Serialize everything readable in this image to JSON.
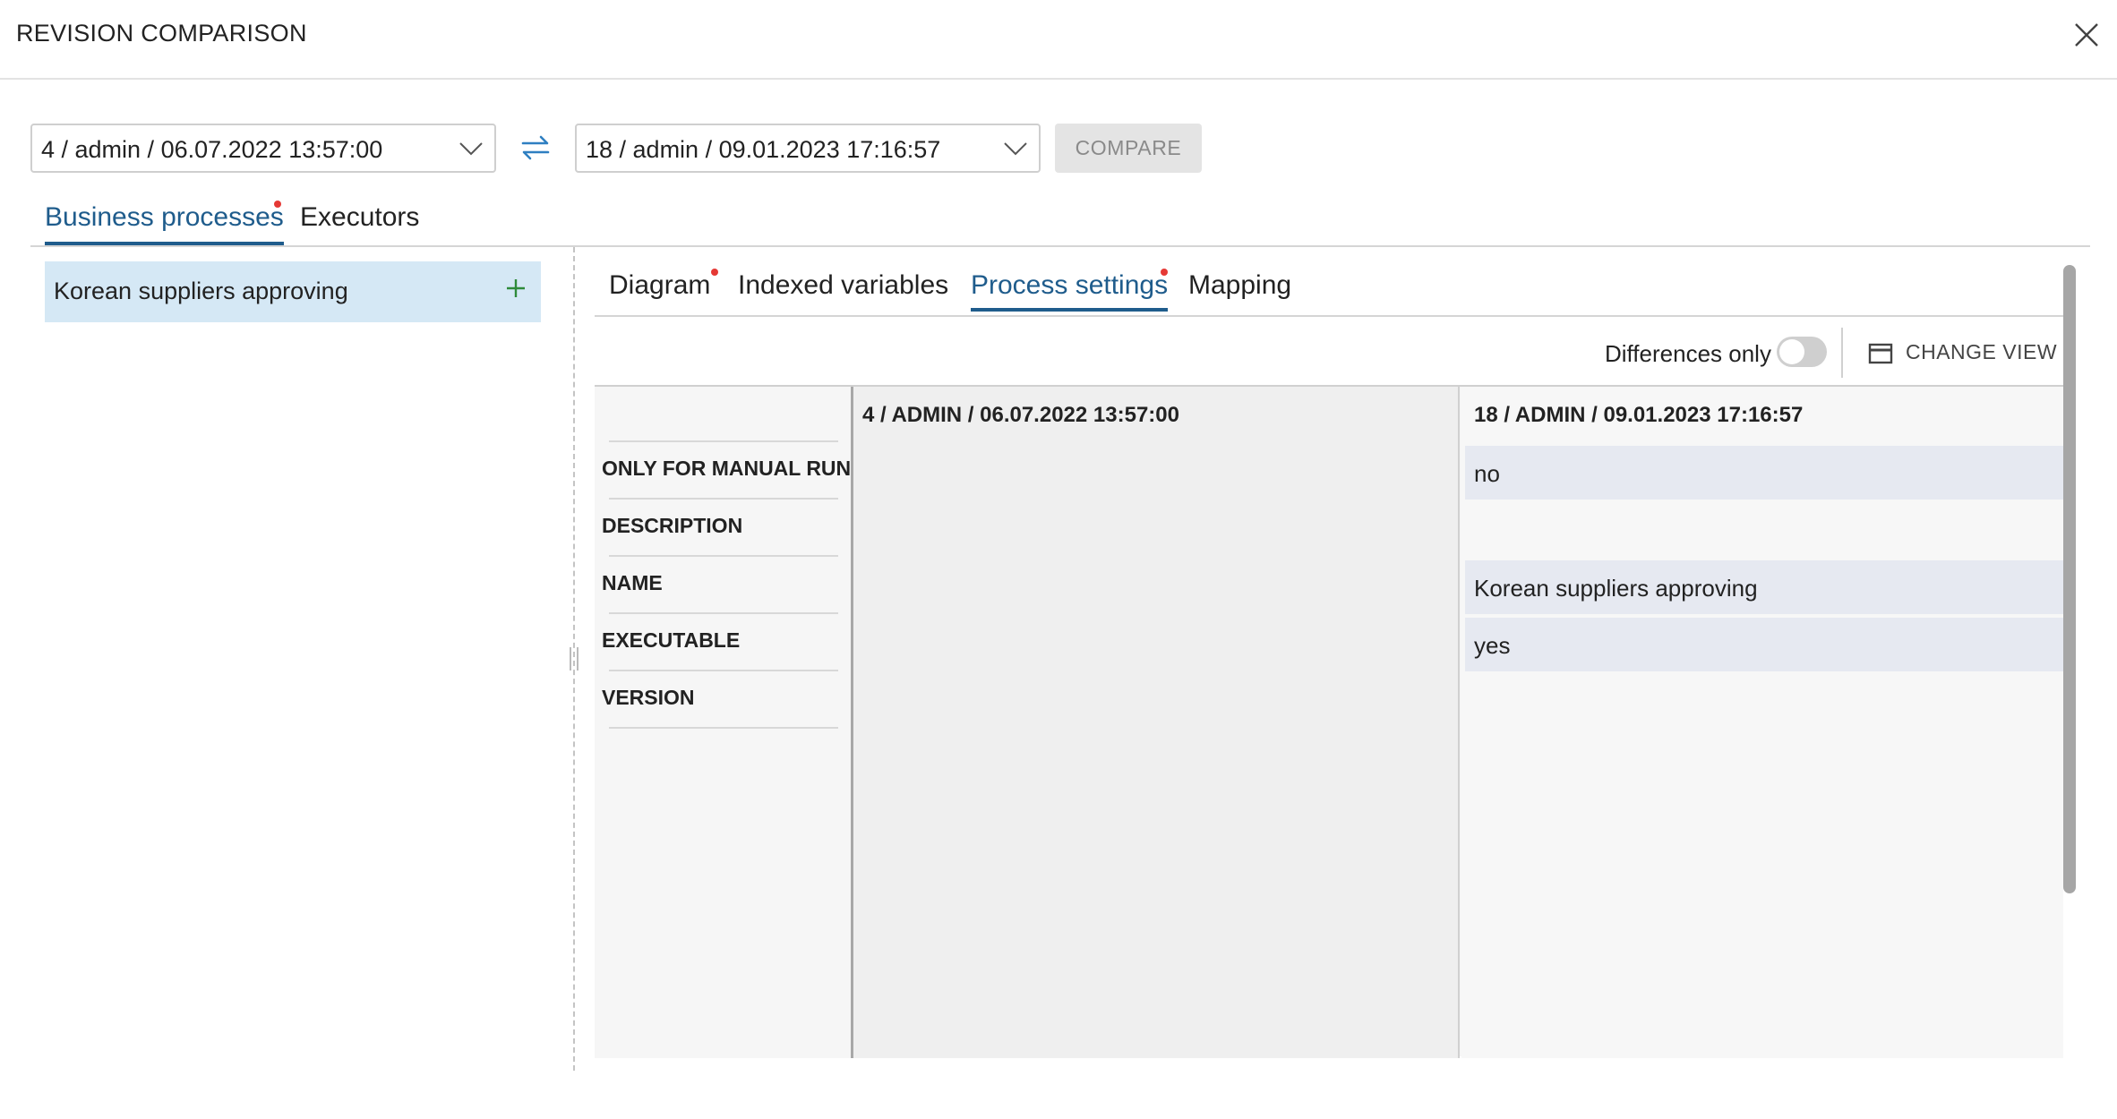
{
  "dialog": {
    "title": "REVISION COMPARISON"
  },
  "revisions": {
    "left_selected": "4 / admin / 06.07.2022 13:57:00",
    "right_selected": "18 / admin / 09.01.2023 17:16:57",
    "compare_label": "COMPARE"
  },
  "main_tabs": [
    {
      "label": "Business processes",
      "active": true,
      "has_changes": true
    },
    {
      "label": "Executors",
      "active": false,
      "has_changes": false
    }
  ],
  "process_list": [
    {
      "label": "Korean suppliers approving",
      "selected": true
    }
  ],
  "sub_tabs": [
    {
      "label": "Diagram",
      "active": false,
      "has_changes": true
    },
    {
      "label": "Indexed variables",
      "active": false,
      "has_changes": false
    },
    {
      "label": "Process settings",
      "active": true,
      "has_changes": true
    },
    {
      "label": "Mapping",
      "active": false,
      "has_changes": false
    }
  ],
  "toolbar": {
    "differences_only_label": "Differences only",
    "differences_only_on": false,
    "change_view_label": "CHANGE VIEW"
  },
  "comparison": {
    "left_header": "4 / ADMIN / 06.07.2022 13:57:00",
    "right_header": "18 / ADMIN / 09.01.2023 17:16:57",
    "rows": [
      {
        "label": "ONLY FOR MANUAL RUN",
        "left": "",
        "right": "no"
      },
      {
        "label": "DESCRIPTION",
        "left": "",
        "right": ""
      },
      {
        "label": "NAME",
        "left": "",
        "right": "Korean suppliers approving"
      },
      {
        "label": "EXECUTABLE",
        "left": "",
        "right": "yes"
      },
      {
        "label": "VERSION",
        "left": "",
        "right": ""
      }
    ]
  },
  "colors": {
    "accent": "#1f5c8c",
    "change_dot": "#e53935",
    "selected_row": "#d5e8f5",
    "diff_cell": "#e6e9f1",
    "plus_icon": "#2e8b3a"
  }
}
